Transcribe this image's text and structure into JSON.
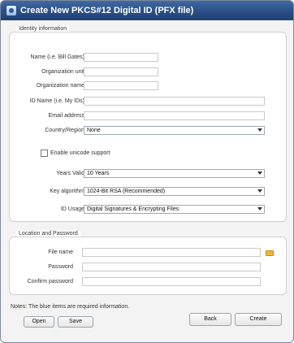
{
  "window": {
    "title": "Create New PKCS#12 Digital ID (PFX file)"
  },
  "identity": {
    "legend": "Identity information",
    "name_label": "Name (i.e. Bill Gates)",
    "name_value": "",
    "org_unit_label": "Organization unit",
    "org_unit_value": "",
    "org_name_label": "Organization name",
    "org_name_value": "",
    "id_name_label": "ID Name (i.e. My IDs)",
    "id_name_value": "",
    "email_label": "Email address",
    "email_value": "",
    "country_label": "Country/Region",
    "country_value": "None",
    "unicode_label": "Enable unicode support",
    "unicode_checked": false,
    "years_label": "Years Valid",
    "years_value": "10 Years",
    "key_algo_label": "Key algorithm",
    "key_algo_value": "1024-Bit RSA (Recommended)",
    "id_usage_label": "ID Usage",
    "id_usage_value": "Digital Signatures & Encrypting Files"
  },
  "location": {
    "legend": "Location and Password",
    "file_name_label": "File name",
    "file_name_value": "",
    "password_label": "Password",
    "password_value": "",
    "confirm_label": "Confirm password",
    "confirm_value": ""
  },
  "footer": {
    "note": "Notes: The blue items are required information.",
    "open_label": "Open",
    "save_label": "Save",
    "back_label": "Back",
    "create_label": "Create"
  },
  "icons": {
    "folder": "folder-icon",
    "combo_arrow": "chevron-down-icon",
    "app": "certificate-icon"
  }
}
